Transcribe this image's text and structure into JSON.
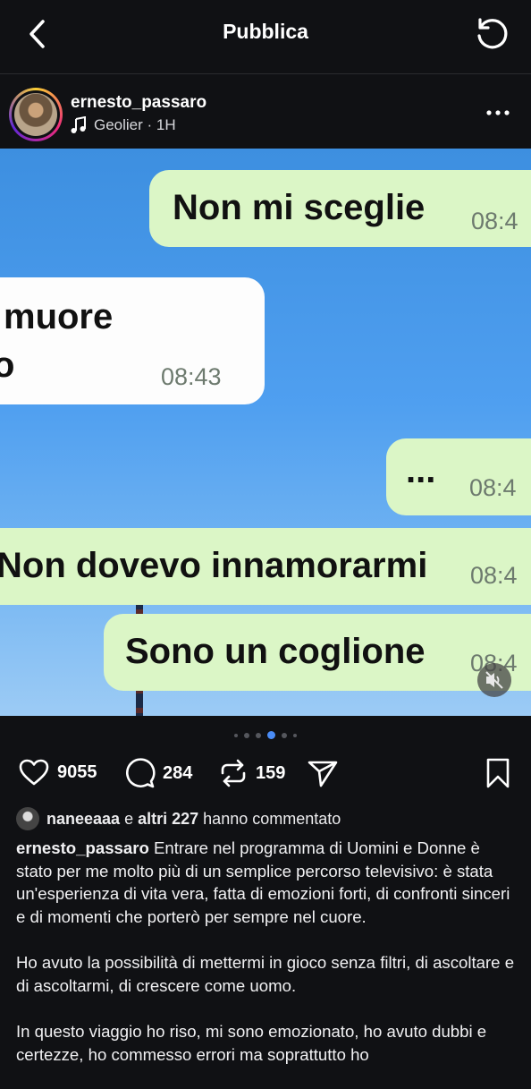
{
  "header": {
    "title": "Pubblica"
  },
  "post": {
    "username": "ernesto_passaro",
    "music": "Geolier · 1H"
  },
  "media": {
    "bubbles": [
      {
        "text": "Non mi sceglie",
        "time": "08:4"
      },
      {
        "text_line1": "muore",
        "text_line2": "o",
        "time": "08:43"
      },
      {
        "text": "...",
        "time": "08:4"
      },
      {
        "text": "Non dovevo innamorarmi",
        "time": "08:4"
      },
      {
        "text": "Sono un coglione",
        "time": "08:4"
      }
    ]
  },
  "actions": {
    "likes": "9055",
    "comments": "284",
    "reposts": "159"
  },
  "commenters": {
    "name": "naneeaaa",
    "middle": "e",
    "others": "altri 227",
    "suffix": "hanno commentato"
  },
  "caption": {
    "username": "ernesto_passaro",
    "p1": "Entrare nel programma di Uomini e Donne è stato per me molto più di un semplice percorso televisivo: è stata un'esperienza di vita vera, fatta di emozioni forti, di confronti sinceri e di momenti che porterò per sempre nel cuore.",
    "p2": "Ho avuto la possibilità di mettermi in gioco senza filtri, di ascoltare e di ascoltarmi, di crescere come uomo.",
    "p3": "In questo viaggio ho riso, mi sono emozionato, ho avuto dubbi e certezze, ho commesso errori ma soprattutto ho"
  },
  "colors": {
    "bubble_green": "#dbf6c6",
    "active_dot": "#4a8cf5",
    "background": "#101114"
  }
}
